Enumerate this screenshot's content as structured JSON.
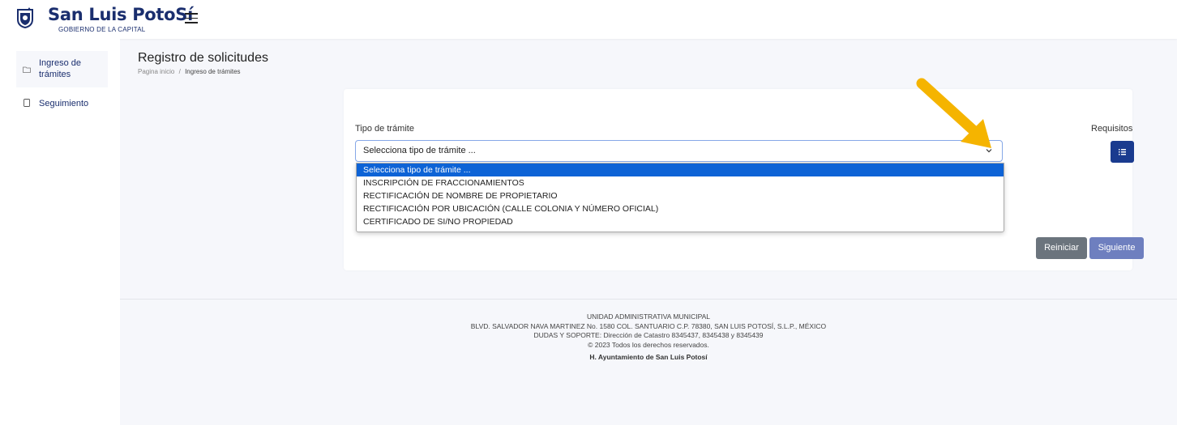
{
  "header": {
    "logo_title": "San Luis PotoSí",
    "logo_subtitle": "GOBIERNO DE LA CAPITAL"
  },
  "sidebar": {
    "items": [
      {
        "label_line1": "Ingreso de",
        "label_line2": "trámites",
        "icon": "folder-icon",
        "active": true
      },
      {
        "label_line1": "Seguimiento",
        "icon": "document-icon",
        "active": false
      }
    ]
  },
  "page": {
    "title": "Registro de solicitudes",
    "breadcrumb_home": "Pagina inicio",
    "breadcrumb_sep": "/",
    "breadcrumb_current": "Ingreso de trámites"
  },
  "form": {
    "field_label": "Tipo de trámite",
    "select_value": "Selecciona tipo de trámite ...",
    "requirements_label": "Requisitos",
    "options": [
      "Selecciona tipo de trámite ...",
      "INSCRIPCIÓN DE FRACCIONAMIENTOS",
      "RECTIFICACIÓN DE NOMBRE DE PROPIETARIO",
      "RECTIFICACIÓN POR UBICACIÓN (CALLE COLONIA Y NÚMERO OFICIAL)",
      "CERTIFICADO DE SI/NO PROPIEDAD"
    ],
    "reset_label": "Reiniciar",
    "next_label": "Siguiente"
  },
  "footer": {
    "line1": "UNIDAD ADMINISTRATIVA MUNICIPAL",
    "line2": "BLVD. SALVADOR NAVA MARTINEZ No. 1580 COL. SANTUARIO C.P. 78380, SAN LUIS POTOSÍ, S.L.P., MÉXICO",
    "line3": "DUDAS Y SOPORTE: Dirección de Catastro 8345437, 8345438 y 8345439",
    "line4": "© 2023 Todos los derechos reservados.",
    "line5": "H. Ayuntamiento de San Luis Potosí"
  },
  "colors": {
    "brand": "#1a2e6e",
    "selected_option": "#0d63d6",
    "annotation_arrow": "#f5b400"
  }
}
